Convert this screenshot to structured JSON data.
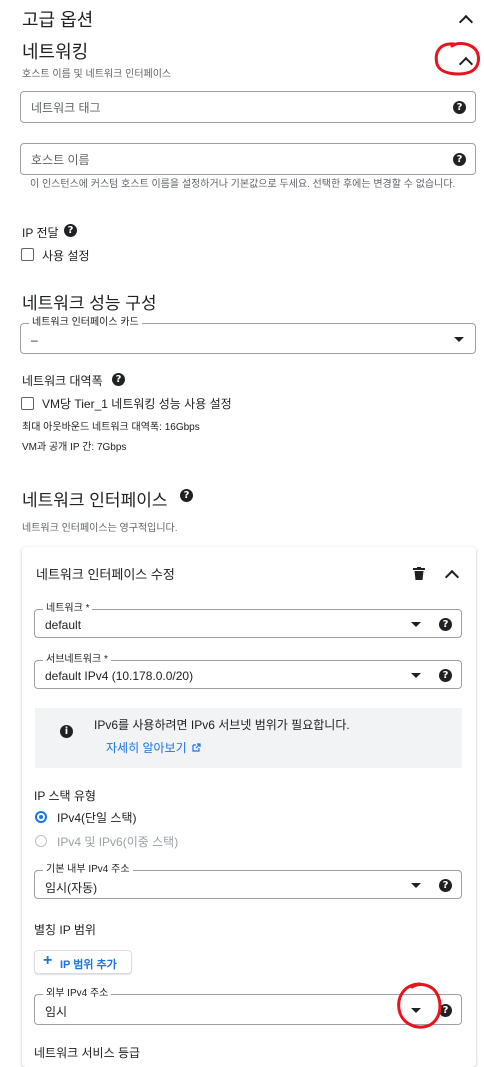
{
  "advanced": {
    "title": "고급 옵션"
  },
  "networking": {
    "title": "네트워킹",
    "subtitle": "호스트 이름 및 네트워크 인터페이스",
    "network_tags_placeholder": "네트워크 태그",
    "hostname_placeholder": "호스트 이름",
    "hostname_helper": "이 인스턴스에 커스텀 호스트 이름을 설정하거나 기본값으로 두세요. 선택한 후에는 변경할 수 없습니다.",
    "ip_forwarding_label": "IP 전달",
    "ip_forwarding_checkbox": "사용 설정"
  },
  "performance": {
    "title": "네트워크 성능 구성",
    "nic_label": "네트워크 인터페이스 카드",
    "nic_value": "–",
    "bandwidth_label": "네트워크 대역폭",
    "tier1_checkbox": "VM당 Tier_1 네트워킹 성능 사용 설정",
    "max_outbound": "최대 아웃바운드 네트워크 대역폭: 16Gbps",
    "vm_public": "VM과 공개 IP 간: 7Gbps"
  },
  "interfaces": {
    "title": "네트워크 인터페이스",
    "subtitle": "네트워크 인터페이스는 영구적입니다."
  },
  "edit_card": {
    "title": "네트워크 인터페이스 수정",
    "network_label": "네트워크 *",
    "network_value": "default",
    "subnet_label": "서브네트워크 *",
    "subnet_value": "default IPv4 (10.178.0.0/20)",
    "info_text": "IPv6를 사용하려면 IPv6 서브넷 범위가 필요합니다.",
    "info_link": "자세히 알아보기",
    "stack_label": "IP 스택 유형",
    "stack_options": [
      "IPv4(단일 스택)",
      "IPv4 및 IPv6(이중 스택)"
    ],
    "stack_selected": 0,
    "internal_ipv4_label": "기본 내부 IPv4 주소",
    "internal_ipv4_value": "임시(자동)",
    "alias_label": "별칭 IP 범위",
    "add_range_button": "IP 범위 추가",
    "external_ipv4_label": "외부 IPv4 주소",
    "external_ipv4_value": "임시",
    "service_tier_label": "네트워크 서비스 등급"
  },
  "colors": {
    "accent": "#1a73e8",
    "annotation": "#e8141d"
  }
}
